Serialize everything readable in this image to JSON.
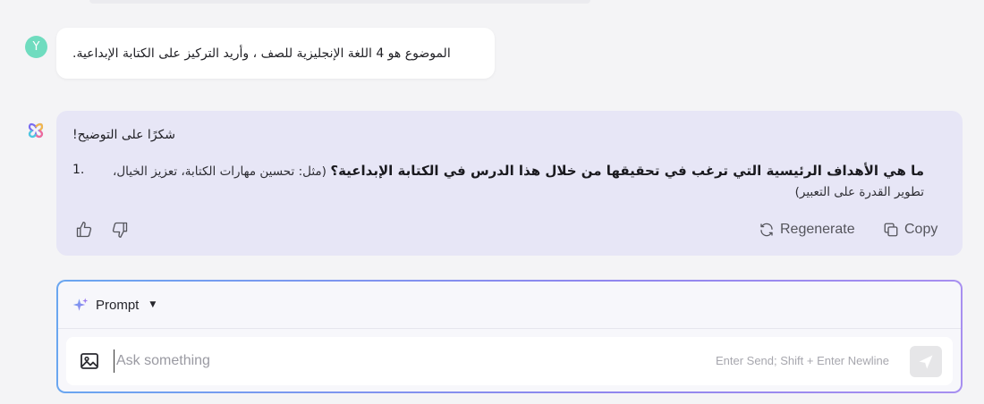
{
  "user_message": {
    "avatar_letter": "Y",
    "text": "الموضوع هو 4 اللغة الإنجليزية للصف ، وأريد التركيز على الكتابة الإبداعية."
  },
  "assistant_message": {
    "greeting": "شكرًا على التوضيح!",
    "list": [
      {
        "number": "1.",
        "question": "ما هي الأهداف الرئيسية التي ترغب في تحقيقها من خلال هذا الدرس في الكتابة الإبداعية؟",
        "example": "(مثل: تحسين مهارات الكتابة، تعزيز الخيال، تطوير القدرة على التعبير)"
      }
    ],
    "regenerate_label": "Regenerate",
    "copy_label": "Copy"
  },
  "composer": {
    "prompt_label": "Prompt",
    "placeholder": "Ask something",
    "hint": "Enter Send; Shift + Enter Newline"
  },
  "colors": {
    "accent_gradient_start": "#6aa6f0",
    "accent_gradient_end": "#a78ff0",
    "assistant_bubble": "#e7e6f6",
    "user_avatar": "#6fdcbf"
  }
}
